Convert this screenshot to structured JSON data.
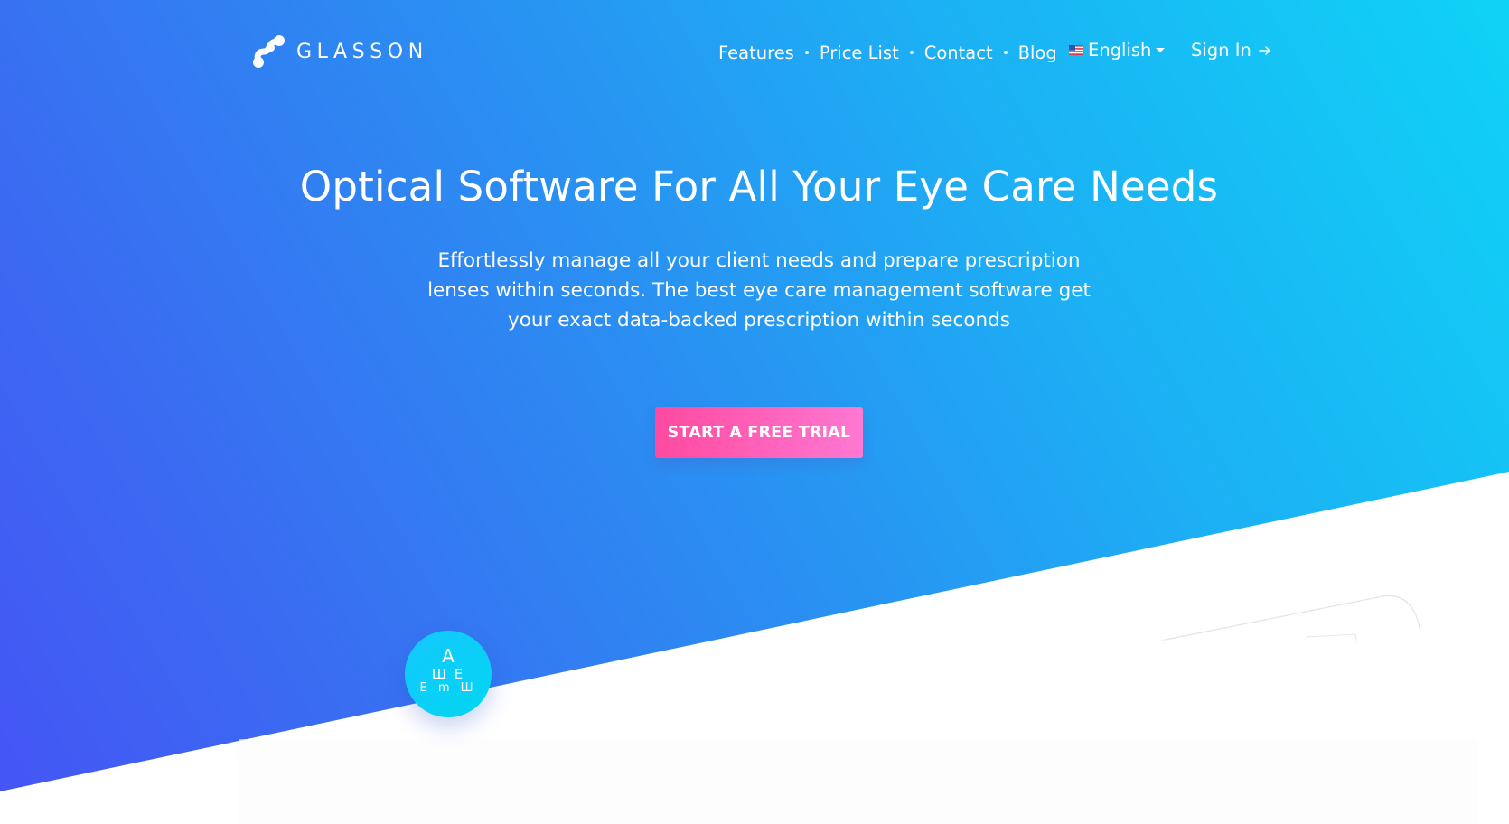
{
  "brand": {
    "name": "GLASSON",
    "logo_icon": "molecule-s-icon"
  },
  "nav": {
    "items": [
      {
        "label": "Features"
      },
      {
        "label": "Price List"
      },
      {
        "label": "Contact"
      },
      {
        "label": "Blog"
      }
    ],
    "language": {
      "label": "English",
      "flag_icon": "us-flag-icon"
    },
    "sign_in": {
      "label": "Sign In",
      "icon": "arrow-right-icon"
    }
  },
  "hero": {
    "title": "Optical Software For All Your Eye Care Needs",
    "subtitle": "Effortlessly manage all your client needs and prepare prescription lenses within seconds. The best eye care management software get your exact data-backed prescription within seconds",
    "cta_label": "START A FREE TRIAL"
  },
  "eye_chart": {
    "line1": "A",
    "line2": "Ш E",
    "line3": "E m Ш"
  },
  "colors": {
    "gradient_start": "#4554f4",
    "gradient_end": "#0fd3f6",
    "cta_start": "#ff4aa0",
    "cta_end": "#ff78d2",
    "text": "#ffffff"
  }
}
